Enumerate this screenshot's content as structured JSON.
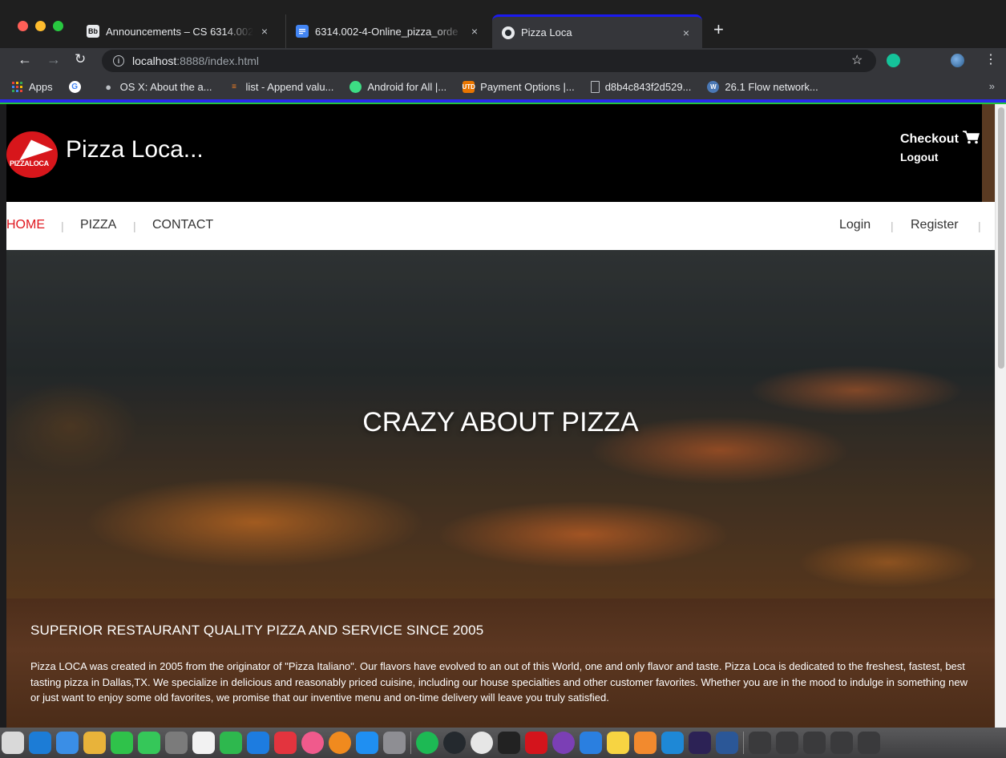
{
  "browser": {
    "tabs": [
      {
        "favicon": "Bb",
        "title": "Announcements – CS 6314.002",
        "close": "×"
      },
      {
        "favicon": "docs-icon",
        "title": "6314.002-4-Online_pizza_orde",
        "close": "×"
      },
      {
        "favicon": "github-icon",
        "title": "Pizza Loca",
        "close": "×"
      }
    ],
    "new_tab": "+",
    "address": {
      "host": "localhost",
      "path": ":8888/index.html"
    },
    "bookmarks": [
      {
        "icon": "apps-grid-icon",
        "label": "Apps"
      },
      {
        "icon": "google-icon",
        "label": ""
      },
      {
        "icon": "apple-icon",
        "label": "OS X: About the a..."
      },
      {
        "icon": "stackoverflow-icon",
        "label": "list - Append valu..."
      },
      {
        "icon": "android-icon",
        "label": "Android for All |..."
      },
      {
        "icon": "utd-icon",
        "label": "Payment Options |..."
      },
      {
        "icon": "file-icon",
        "label": "d8b4c843f2d529..."
      },
      {
        "icon": "wiki-icon",
        "label": "26.1 Flow network..."
      }
    ],
    "bookmarks_more": "»"
  },
  "site": {
    "brand": "Pizza Loca...",
    "logo_text": "PIZZALOCA",
    "checkout": "Checkout",
    "logout": "Logout",
    "nav": {
      "home": "HOME",
      "pizza": "PIZZA",
      "contact": "CONTACT",
      "login": "Login",
      "register": "Register",
      "separator": "|"
    },
    "hero_title": "CRAZY ABOUT PIZZA",
    "about_heading": "SUPERIOR RESTAURANT QUALITY PIZZA AND SERVICE SINCE 2005",
    "about_text": "Pizza LOCA was created in 2005 from the originator of \"Pizza Italiano\". Our flavors have evolved to an out of this World, one and only flavor and taste. Pizza Loca is dedicated to the freshest, fastest, best tasting pizza in Dallas,TX. We specialize in delicious and reasonably priced cuisine, including our house specialties and other customer favorites. Whether you are in the mood to indulge in something new or just want to enjoy some old favorites, we promise that our inventive menu and on-time delivery will leave you truly satisfied."
  },
  "colors": {
    "accent_red": "#e0161e",
    "tab_indicator": "#1a1af0",
    "header_bg": "#000000",
    "about_bg": "#5c3721"
  },
  "dock_apps": [
    "finder-icon",
    "notes-icon",
    "preview-icon",
    "photos-icon",
    "messages-icon",
    "facetime-icon",
    "help-icon",
    "calendar-icon",
    "numbers-icon",
    "keynote-icon",
    "news-icon",
    "itunes-icon",
    "books-icon",
    "appstore-icon",
    "system-prefs-icon",
    "spotify-icon",
    "github-icon",
    "chrome-icon",
    "terminal-icon",
    "acrobat-icon",
    "github-desktop-icon",
    "xcode-icon",
    "notes-yellow-icon",
    "sublime-icon",
    "vscode-icon",
    "eclipse-icon",
    "word-icon",
    "window-thumb-icon",
    "window-thumb-icon",
    "window-thumb-icon",
    "window-thumb-icon",
    "window-thumb-icon"
  ]
}
